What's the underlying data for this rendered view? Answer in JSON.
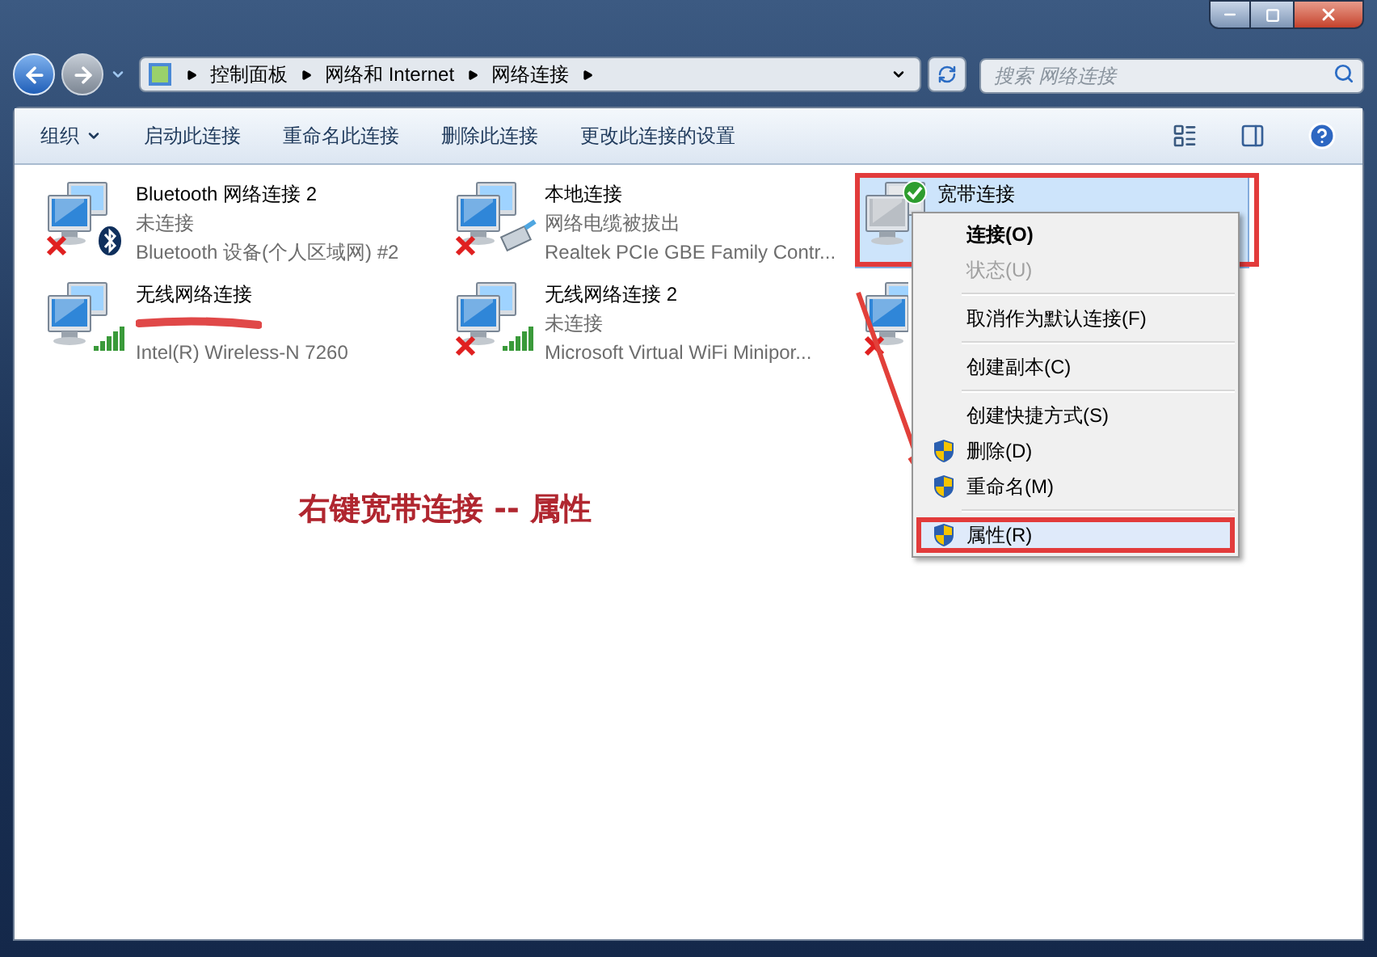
{
  "address": {
    "crumbs": [
      "控制面板",
      "网络和 Internet",
      "网络连接"
    ],
    "search_placeholder": "搜索 网络连接"
  },
  "toolbar": {
    "buttons": [
      {
        "label": "组织",
        "dropdown": true
      },
      {
        "label": "启动此连接",
        "dropdown": false
      },
      {
        "label": "重命名此连接",
        "dropdown": false
      },
      {
        "label": "删除此连接",
        "dropdown": false
      },
      {
        "label": "更改此连接的设置",
        "dropdown": false
      }
    ]
  },
  "connections": [
    {
      "kind": "bluetooth",
      "name": "Bluetooth 网络连接 2",
      "status": "未连接",
      "device": "Bluetooth 设备(个人区域网) #2",
      "disconnected": true,
      "connected": false,
      "selected": false,
      "redacted": false
    },
    {
      "kind": "ethernet",
      "name": "本地连接",
      "status": "网络电缆被拔出",
      "device": "Realtek PCIe GBE Family Contr...",
      "disconnected": true,
      "connected": false,
      "selected": false,
      "redacted": false
    },
    {
      "kind": "broadband",
      "name": "宽带连接",
      "disconnected": false,
      "connected": true,
      "selected": true,
      "redacted": false
    },
    {
      "kind": "wireless",
      "name": "无线网络连接",
      "device": "Intel(R) Wireless-N 7260",
      "disconnected": false,
      "connected": false,
      "selected": false,
      "redacted": true
    },
    {
      "kind": "wireless",
      "name": "无线网络连接 2",
      "status": "未连接",
      "device": "Microsoft Virtual WiFi Minipor...",
      "disconnected": true,
      "connected": false,
      "selected": false,
      "redacted": false
    },
    {
      "kind": "wireless",
      "disconnected": true,
      "connected": false,
      "selected": false,
      "redacted": false
    }
  ],
  "context_menu": [
    {
      "kind": "default",
      "label": "连接(O)",
      "selected": false
    },
    {
      "kind": "disabled",
      "label": "状态(U)",
      "selected": false
    },
    {
      "kind": "separator"
    },
    {
      "kind": "item",
      "label": "取消作为默认连接(F)",
      "selected": false
    },
    {
      "kind": "separator"
    },
    {
      "kind": "item",
      "label": "创建副本(C)",
      "selected": false
    },
    {
      "kind": "separator"
    },
    {
      "kind": "item",
      "label": "创建快捷方式(S)",
      "selected": false
    },
    {
      "kind": "shield",
      "label": "删除(D)",
      "selected": false
    },
    {
      "kind": "shield",
      "label": "重命名(M)",
      "selected": false
    },
    {
      "kind": "separator"
    },
    {
      "kind": "shield",
      "label": "属性(R)",
      "selected": true
    }
  ],
  "annotation": {
    "text": "右键宽带连接 -- 属性"
  }
}
